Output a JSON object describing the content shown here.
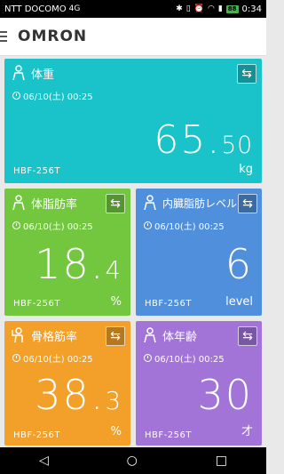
{
  "status_bar": {
    "carrier": "NTT DOCOMO",
    "left_badge": "4G",
    "battery": "88",
    "time": "0:34"
  },
  "app": {
    "brand": "OMRON"
  },
  "cards": [
    {
      "title": "体重",
      "datetime": "06/10(土) 00:25",
      "value_int": "65.",
      "value_dec": "50",
      "unit": "kg",
      "device": "HBF-256T"
    },
    {
      "title": "体脂肪率",
      "datetime": "06/10(土) 00:25",
      "value_int": "18.",
      "value_dec": "4",
      "unit": "%",
      "device": "HBF-256T"
    },
    {
      "title": "内臓脂肪レベル",
      "datetime": "06/10(土) 00:25",
      "value_int": "6",
      "value_dec": "",
      "unit": "level",
      "device": "HBF-256T"
    },
    {
      "title": "骨格筋率",
      "datetime": "06/10(土) 00:25",
      "value_int": "38.",
      "value_dec": "3",
      "unit": "%",
      "device": "HBF-256T"
    },
    {
      "title": "体年齢",
      "datetime": "06/10(土) 00:25",
      "value_int": "30",
      "value_dec": "",
      "unit": "才",
      "device": "HBF-256T"
    }
  ],
  "colors": {
    "weight": "#1ac2c9",
    "body_fat": "#72c73f",
    "visceral": "#4f8fdc",
    "muscle": "#f2a02a",
    "age": "#a374d8"
  },
  "nav": {
    "back": "◁",
    "home": "○",
    "recent": "□"
  }
}
